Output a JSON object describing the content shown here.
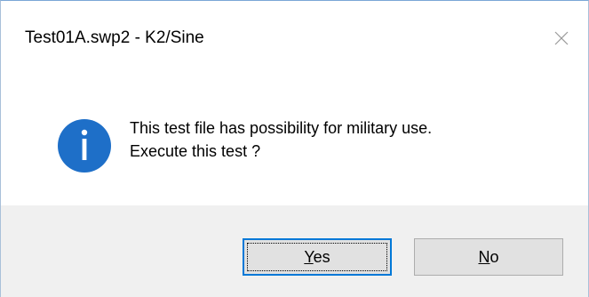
{
  "window": {
    "title": "Test01A.swp2 - K2/Sine",
    "close_icon": "close-icon"
  },
  "message": {
    "icon": "info-icon",
    "icon_color": "#1e6fc8",
    "line1": "This test file has possibility for military use.",
    "line2": "Execute this test ?"
  },
  "buttons": {
    "yes": {
      "accel": "Y",
      "rest": "es",
      "focused": true,
      "focus_color": "#0078d7"
    },
    "no": {
      "accel": "N",
      "rest": "o",
      "focused": false
    }
  }
}
